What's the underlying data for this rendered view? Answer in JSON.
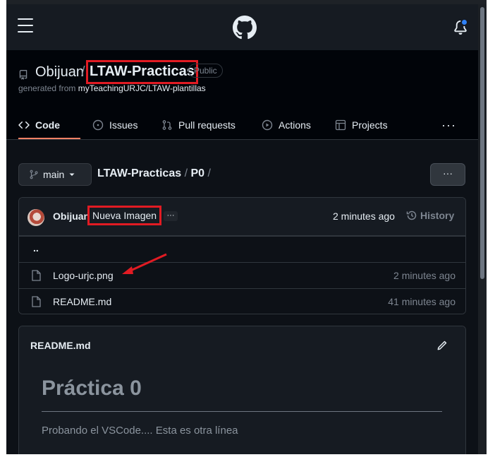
{
  "header": {
    "menu_icon": "hamburger-icon",
    "logo_icon": "github-logo-icon",
    "notification_icon": "bell-icon",
    "accent_color": "#2f81f7"
  },
  "repo": {
    "owner": "Obijuan",
    "separator": "/",
    "name": "LTAW-Practicas",
    "visibility": "Public",
    "generated_prefix": "generated from ",
    "template": "myTeachingURJC/LTAW-plantillas"
  },
  "tabs": [
    {
      "label": "Code",
      "icon": "code-icon"
    },
    {
      "label": "Issues",
      "icon": "issue-circle-icon"
    },
    {
      "label": "Pull requests",
      "icon": "pull-request-icon"
    },
    {
      "label": "Actions",
      "icon": "play-icon"
    },
    {
      "label": "Projects",
      "icon": "table-icon"
    }
  ],
  "more_label": "···",
  "branch": {
    "label": "main"
  },
  "breadcrumb": {
    "repo": "LTAW-Practicas",
    "sep1": " / ",
    "folder": "P0",
    "sep2": " /"
  },
  "menu_button_label": "···",
  "commit": {
    "author": "Obijuan",
    "message": "Nueva Imagen",
    "ellipsis": "···",
    "time": "2 minutes ago",
    "history_label": "History"
  },
  "files": {
    "updir": "..",
    "items": [
      {
        "name": "Logo-urjc.png",
        "time": "2 minutes ago"
      },
      {
        "name": "README.md",
        "time": "41 minutes ago"
      }
    ]
  },
  "readme": {
    "filename": "README.md",
    "heading": "Práctica 0",
    "paragraph": "Probando el VSCode.... Esta es otra línea"
  },
  "annotation_color": "#e11b23"
}
